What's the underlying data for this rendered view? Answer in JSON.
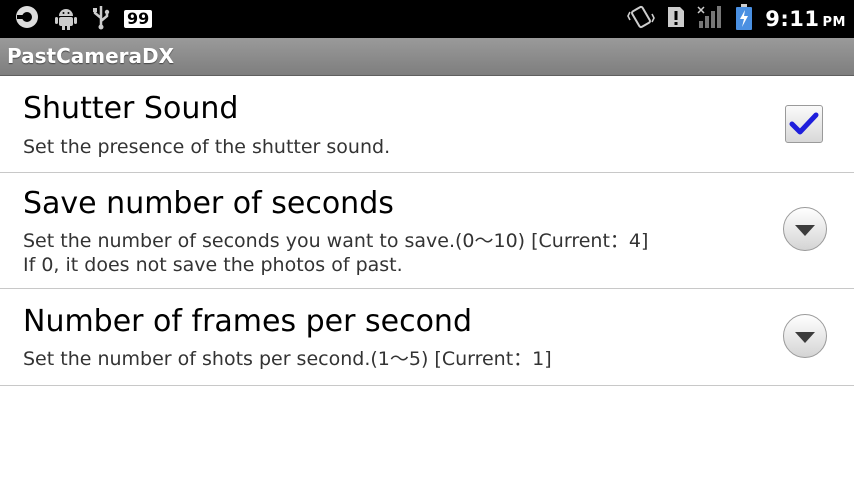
{
  "status_bar": {
    "notification_count": "99",
    "time": "9:11",
    "ampm": "PM",
    "battery_color": "#4a90e2"
  },
  "app": {
    "title": "PastCameraDX"
  },
  "settings": [
    {
      "title": "Shutter Sound",
      "summary": "Set the presence of the shutter sound.",
      "control": "checkbox",
      "checked": true,
      "check_color": "#1e1edc"
    },
    {
      "title": "Save number of seconds",
      "summary": "Set the number of seconds you want to save.(0〜10) [Current：4]\nIf 0, it does not save the photos of past.",
      "control": "dropdown"
    },
    {
      "title": "Number of frames per second",
      "summary": "Set the number of shots per second.(1〜5) [Current：1]",
      "control": "dropdown"
    }
  ]
}
